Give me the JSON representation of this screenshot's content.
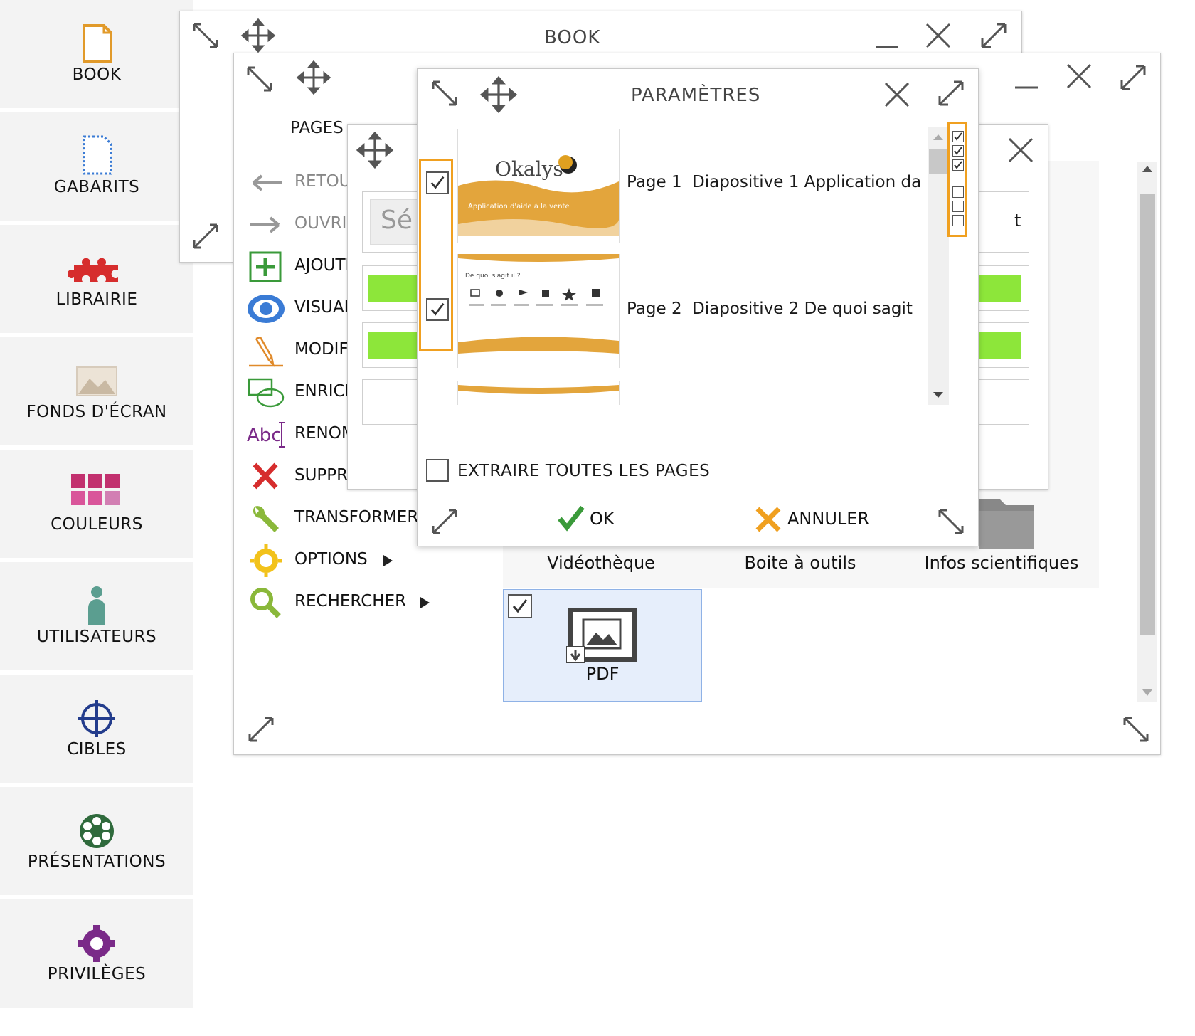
{
  "sidebar": {
    "items": [
      {
        "label": "BOOK",
        "icon": "book-icon"
      },
      {
        "label": "GABARITS",
        "icon": "template-icon"
      },
      {
        "label": "LIBRAIRIE",
        "icon": "puzzle-icon"
      },
      {
        "label": "FONDS D'ÉCRAN",
        "icon": "landscape-icon"
      },
      {
        "label": "COULEURS",
        "icon": "color-grid-icon"
      },
      {
        "label": "UTILISATEURS",
        "icon": "user-icon"
      },
      {
        "label": "CIBLES",
        "icon": "target-icon"
      },
      {
        "label": "PRÉSENTATIONS",
        "icon": "film-reel-icon"
      },
      {
        "label": "PRIVILÈGES",
        "icon": "gear-icon"
      }
    ]
  },
  "book_window": {
    "title": "BOOK"
  },
  "pages_window": {
    "title": "PAGES",
    "menu": [
      {
        "label": "RETOUR",
        "icon": "arrow-left-icon"
      },
      {
        "label": "OUVRIR",
        "icon": "arrow-right-icon"
      },
      {
        "label": "AJOUTER",
        "icon": "plus-box-icon"
      },
      {
        "label": "VISUALISER",
        "icon": "eye-icon"
      },
      {
        "label": "MODIFIER",
        "icon": "pencil-icon"
      },
      {
        "label": "ENRICHIR",
        "icon": "shapes-icon"
      },
      {
        "label": "RENOMMER",
        "icon": "rename-icon"
      },
      {
        "label": "SUPPRIMER",
        "icon": "red-x-icon"
      },
      {
        "label": "TRANSFORMER",
        "icon": "wrench-icon"
      },
      {
        "label": "OPTIONS",
        "icon": "sun-gear-icon"
      },
      {
        "label": "RECHERCHER",
        "icon": "magnifier-icon"
      }
    ],
    "search_placeholder": "Sé",
    "partial_text": "t",
    "tiles": [
      {
        "label": "Vidéothèque"
      },
      {
        "label": "Boite à outils"
      },
      {
        "label": "Infos scientifiques"
      },
      {
        "label": "PDF"
      }
    ]
  },
  "params_dialog": {
    "title": "PARAMÈTRES",
    "pages": [
      {
        "page": "Page 1",
        "text": "Diapositive 1 Application da",
        "checked": true,
        "thumb_brand": "Okalys",
        "thumb_caption": "Application d'aide à la vente"
      },
      {
        "page": "Page 2",
        "text": "Diapositive 2 De quoi sagit",
        "checked": true,
        "thumb_heading": "De quoi s'agit il ?"
      }
    ],
    "mini_checks": [
      true,
      true,
      true,
      false,
      false,
      false
    ],
    "extract_all_label": "EXTRAIRE TOUTES LES PAGES",
    "ok_label": "OK",
    "cancel_label": "ANNULER"
  },
  "colors": {
    "accent_orange": "#f0a020",
    "green_bar": "#8de63a",
    "selected_tile": "#e6eefb"
  }
}
